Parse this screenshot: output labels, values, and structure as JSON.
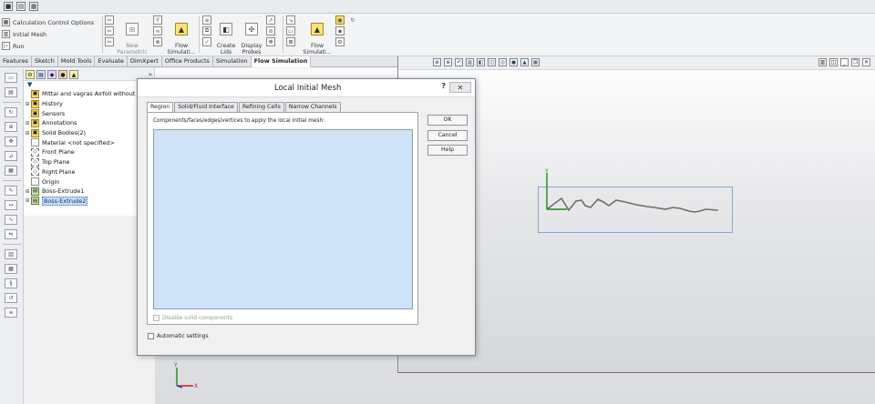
{
  "quickbar": {
    "icons": [
      "camera-icon",
      "gallery-icon",
      "layers-icon"
    ]
  },
  "ribbon": {
    "left": [
      {
        "icon": "calculator-icon",
        "label": "Calculation Control Options"
      },
      {
        "icon": "mesh-icon",
        "label": "Initial Mesh"
      },
      {
        "icon": "play-icon",
        "label": "Run"
      }
    ],
    "new_parametric_study": "New\nParametric\nStudy",
    "flow_simulation_1": "Flow\nSimulati...",
    "create_lids": "Create\nLids",
    "display_probes": "Display\nProbes",
    "flow_simulation_2": "Flow\nSimulati..."
  },
  "cmd_tabs": [
    {
      "label": "Features",
      "active": false
    },
    {
      "label": "Sketch",
      "active": false
    },
    {
      "label": "Mold Tools",
      "active": false
    },
    {
      "label": "Evaluate",
      "active": false
    },
    {
      "label": "DimXpert",
      "active": false
    },
    {
      "label": "Office Products",
      "active": false
    },
    {
      "label": "Simulation",
      "active": false
    },
    {
      "label": "Flow Simulation",
      "active": true
    }
  ],
  "tree": {
    "expand_glyph": "»",
    "filter_glyph": "▼",
    "items": [
      {
        "label": "Mittal and vagras Airfoil without fil",
        "exp": "",
        "icon": "part-icon",
        "kind": "folder"
      },
      {
        "label": "History",
        "exp": "⊞",
        "icon": "history-icon",
        "kind": "folder"
      },
      {
        "label": "Sensors",
        "exp": "",
        "icon": "sensor-icon",
        "kind": "folder"
      },
      {
        "label": "Annotations",
        "exp": "⊞",
        "icon": "annotation-icon",
        "kind": "folder"
      },
      {
        "label": "Solid Bodies(2)",
        "exp": "⊞",
        "icon": "solid-bodies-icon",
        "kind": "folder"
      },
      {
        "label": "Material <not specified>",
        "exp": "",
        "icon": "material-icon",
        "kind": "plain"
      },
      {
        "label": "Front Plane",
        "exp": "",
        "icon": "plane-icon",
        "kind": "plane"
      },
      {
        "label": "Top Plane",
        "exp": "",
        "icon": "plane-icon",
        "kind": "plane"
      },
      {
        "label": "Right Plane",
        "exp": "",
        "icon": "plane-icon",
        "kind": "plane"
      },
      {
        "label": "Origin",
        "exp": "",
        "icon": "origin-icon",
        "kind": "plain"
      },
      {
        "label": "Boss-Extrude1",
        "exp": "⊞",
        "icon": "extrude-icon",
        "kind": "extrude"
      },
      {
        "label": "Boss-Extrude2",
        "exp": "⊞",
        "icon": "extrude-icon",
        "kind": "extrude",
        "selected": true
      }
    ]
  },
  "dialog": {
    "title": "Local Initial Mesh",
    "help_glyph": "?",
    "close_glyph": "✕",
    "tabs": [
      {
        "label": "Region",
        "active": true
      },
      {
        "label": "Solid/Fluid Interface",
        "active": false
      },
      {
        "label": "Refining Cells",
        "active": false
      },
      {
        "label": "Narrow Channels",
        "active": false
      }
    ],
    "caption": "Components/faces/edges/vertices to apply the local initial mesh:",
    "disable_solid_components": "Disable solid components",
    "automatic_settings": "Automatic settings",
    "ok": "OK",
    "cancel": "Cancel",
    "help": "Help"
  },
  "triad": {
    "y": "Y",
    "x": "X"
  },
  "colors": {
    "selection_blue": "#cfe3f8",
    "bbox_blue": "#7fa8dc",
    "axis_green": "#1a8a1a",
    "axis_red": "#d01818",
    "axis_blue": "#1a3fd0"
  }
}
